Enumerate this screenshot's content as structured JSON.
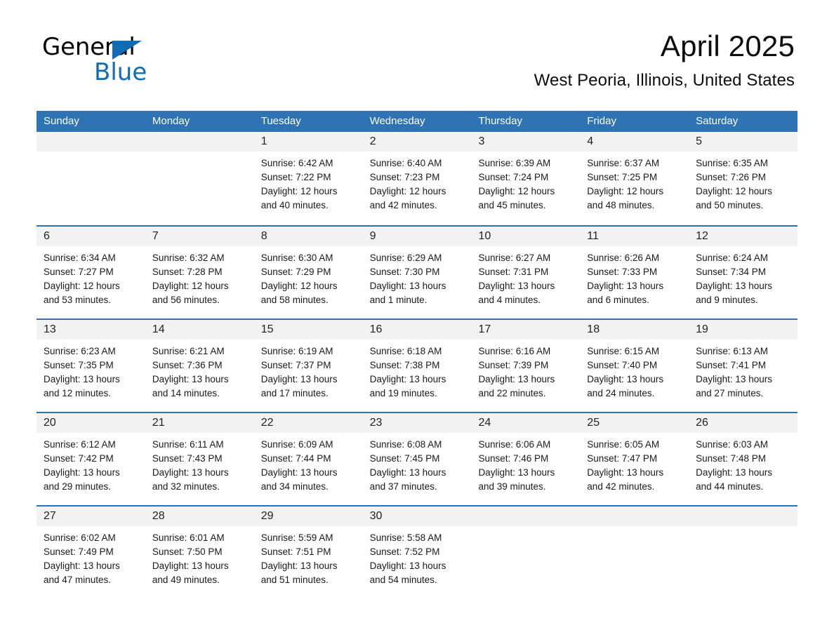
{
  "brand": {
    "name_part1": "General",
    "name_part2": "Blue"
  },
  "header": {
    "title": "April 2025",
    "subtitle": "West Peoria, Illinois, United States"
  },
  "colors": {
    "header_blue": "#2e74b5",
    "logo_blue": "#0f6cb5",
    "day_number_bg": "#f2f2f2"
  },
  "weekdays": [
    "Sunday",
    "Monday",
    "Tuesday",
    "Wednesday",
    "Thursday",
    "Friday",
    "Saturday"
  ],
  "weeks": [
    [
      {
        "day": "",
        "lines": []
      },
      {
        "day": "",
        "lines": []
      },
      {
        "day": "1",
        "lines": [
          "Sunrise: 6:42 AM",
          "Sunset: 7:22 PM",
          "Daylight: 12 hours",
          "and 40 minutes."
        ]
      },
      {
        "day": "2",
        "lines": [
          "Sunrise: 6:40 AM",
          "Sunset: 7:23 PM",
          "Daylight: 12 hours",
          "and 42 minutes."
        ]
      },
      {
        "day": "3",
        "lines": [
          "Sunrise: 6:39 AM",
          "Sunset: 7:24 PM",
          "Daylight: 12 hours",
          "and 45 minutes."
        ]
      },
      {
        "day": "4",
        "lines": [
          "Sunrise: 6:37 AM",
          "Sunset: 7:25 PM",
          "Daylight: 12 hours",
          "and 48 minutes."
        ]
      },
      {
        "day": "5",
        "lines": [
          "Sunrise: 6:35 AM",
          "Sunset: 7:26 PM",
          "Daylight: 12 hours",
          "and 50 minutes."
        ]
      }
    ],
    [
      {
        "day": "6",
        "lines": [
          "Sunrise: 6:34 AM",
          "Sunset: 7:27 PM",
          "Daylight: 12 hours",
          "and 53 minutes."
        ]
      },
      {
        "day": "7",
        "lines": [
          "Sunrise: 6:32 AM",
          "Sunset: 7:28 PM",
          "Daylight: 12 hours",
          "and 56 minutes."
        ]
      },
      {
        "day": "8",
        "lines": [
          "Sunrise: 6:30 AM",
          "Sunset: 7:29 PM",
          "Daylight: 12 hours",
          "and 58 minutes."
        ]
      },
      {
        "day": "9",
        "lines": [
          "Sunrise: 6:29 AM",
          "Sunset: 7:30 PM",
          "Daylight: 13 hours",
          "and 1 minute."
        ]
      },
      {
        "day": "10",
        "lines": [
          "Sunrise: 6:27 AM",
          "Sunset: 7:31 PM",
          "Daylight: 13 hours",
          "and 4 minutes."
        ]
      },
      {
        "day": "11",
        "lines": [
          "Sunrise: 6:26 AM",
          "Sunset: 7:33 PM",
          "Daylight: 13 hours",
          "and 6 minutes."
        ]
      },
      {
        "day": "12",
        "lines": [
          "Sunrise: 6:24 AM",
          "Sunset: 7:34 PM",
          "Daylight: 13 hours",
          "and 9 minutes."
        ]
      }
    ],
    [
      {
        "day": "13",
        "lines": [
          "Sunrise: 6:23 AM",
          "Sunset: 7:35 PM",
          "Daylight: 13 hours",
          "and 12 minutes."
        ]
      },
      {
        "day": "14",
        "lines": [
          "Sunrise: 6:21 AM",
          "Sunset: 7:36 PM",
          "Daylight: 13 hours",
          "and 14 minutes."
        ]
      },
      {
        "day": "15",
        "lines": [
          "Sunrise: 6:19 AM",
          "Sunset: 7:37 PM",
          "Daylight: 13 hours",
          "and 17 minutes."
        ]
      },
      {
        "day": "16",
        "lines": [
          "Sunrise: 6:18 AM",
          "Sunset: 7:38 PM",
          "Daylight: 13 hours",
          "and 19 minutes."
        ]
      },
      {
        "day": "17",
        "lines": [
          "Sunrise: 6:16 AM",
          "Sunset: 7:39 PM",
          "Daylight: 13 hours",
          "and 22 minutes."
        ]
      },
      {
        "day": "18",
        "lines": [
          "Sunrise: 6:15 AM",
          "Sunset: 7:40 PM",
          "Daylight: 13 hours",
          "and 24 minutes."
        ]
      },
      {
        "day": "19",
        "lines": [
          "Sunrise: 6:13 AM",
          "Sunset: 7:41 PM",
          "Daylight: 13 hours",
          "and 27 minutes."
        ]
      }
    ],
    [
      {
        "day": "20",
        "lines": [
          "Sunrise: 6:12 AM",
          "Sunset: 7:42 PM",
          "Daylight: 13 hours",
          "and 29 minutes."
        ]
      },
      {
        "day": "21",
        "lines": [
          "Sunrise: 6:11 AM",
          "Sunset: 7:43 PM",
          "Daylight: 13 hours",
          "and 32 minutes."
        ]
      },
      {
        "day": "22",
        "lines": [
          "Sunrise: 6:09 AM",
          "Sunset: 7:44 PM",
          "Daylight: 13 hours",
          "and 34 minutes."
        ]
      },
      {
        "day": "23",
        "lines": [
          "Sunrise: 6:08 AM",
          "Sunset: 7:45 PM",
          "Daylight: 13 hours",
          "and 37 minutes."
        ]
      },
      {
        "day": "24",
        "lines": [
          "Sunrise: 6:06 AM",
          "Sunset: 7:46 PM",
          "Daylight: 13 hours",
          "and 39 minutes."
        ]
      },
      {
        "day": "25",
        "lines": [
          "Sunrise: 6:05 AM",
          "Sunset: 7:47 PM",
          "Daylight: 13 hours",
          "and 42 minutes."
        ]
      },
      {
        "day": "26",
        "lines": [
          "Sunrise: 6:03 AM",
          "Sunset: 7:48 PM",
          "Daylight: 13 hours",
          "and 44 minutes."
        ]
      }
    ],
    [
      {
        "day": "27",
        "lines": [
          "Sunrise: 6:02 AM",
          "Sunset: 7:49 PM",
          "Daylight: 13 hours",
          "and 47 minutes."
        ]
      },
      {
        "day": "28",
        "lines": [
          "Sunrise: 6:01 AM",
          "Sunset: 7:50 PM",
          "Daylight: 13 hours",
          "and 49 minutes."
        ]
      },
      {
        "day": "29",
        "lines": [
          "Sunrise: 5:59 AM",
          "Sunset: 7:51 PM",
          "Daylight: 13 hours",
          "and 51 minutes."
        ]
      },
      {
        "day": "30",
        "lines": [
          "Sunrise: 5:58 AM",
          "Sunset: 7:52 PM",
          "Daylight: 13 hours",
          "and 54 minutes."
        ]
      },
      {
        "day": "",
        "lines": []
      },
      {
        "day": "",
        "lines": []
      },
      {
        "day": "",
        "lines": []
      }
    ]
  ]
}
